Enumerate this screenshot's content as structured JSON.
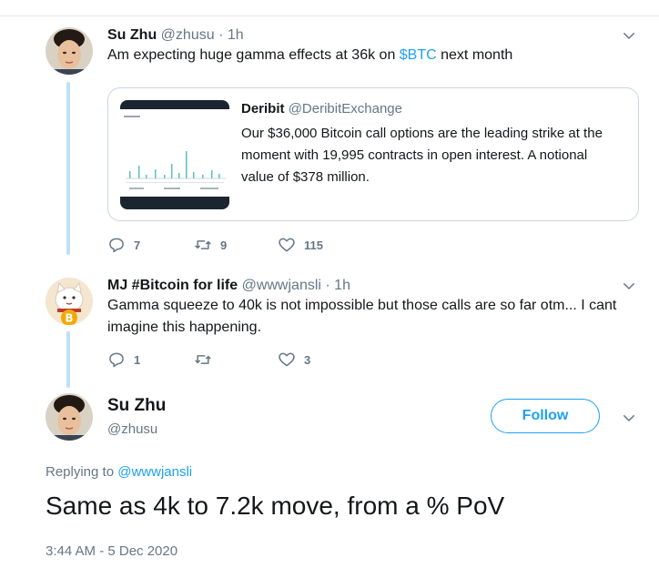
{
  "tweet1": {
    "author_name": "Su Zhu",
    "handle": "@zhusu",
    "time": "· 1h",
    "text_before": "Am expecting huge gamma effects at 36k on ",
    "cashtag": "$BTC",
    "text_after": " next month",
    "quote": {
      "author_name": "Deribit",
      "handle": "@DeribitExchange",
      "text": "Our $36,000 Bitcoin call options are the leading strike at the moment with 19,995 contracts in open interest. A notional value of $378 million."
    },
    "replies": "7",
    "retweets": "9",
    "likes": "115"
  },
  "tweet2": {
    "author_name": "MJ #Bitcoin for life",
    "handle": "@wwwjansli",
    "time": "· 1h",
    "text": "Gamma squeeze to 40k is not impossible but those calls are so far otm... I cant imagine this happening.",
    "replies": "1",
    "retweets": "",
    "likes": "3"
  },
  "main_tweet": {
    "author_name": "Su Zhu",
    "handle": "@zhusu",
    "follow_label": "Follow",
    "replying_prefix": "Replying to ",
    "replying_handle": "@wwwjansli",
    "text": "Same as 4k to 7.2k move, from a % PoV",
    "timestamp": "3:44 AM - 5 Dec 2020"
  },
  "colors": {
    "accent": "#1da1f2",
    "muted": "#657786",
    "thread_line": "#bfe0f7",
    "border": "#ccd6dd"
  },
  "icons": [
    "reply-icon",
    "retweet-icon",
    "like-icon",
    "chevron-down-icon"
  ]
}
